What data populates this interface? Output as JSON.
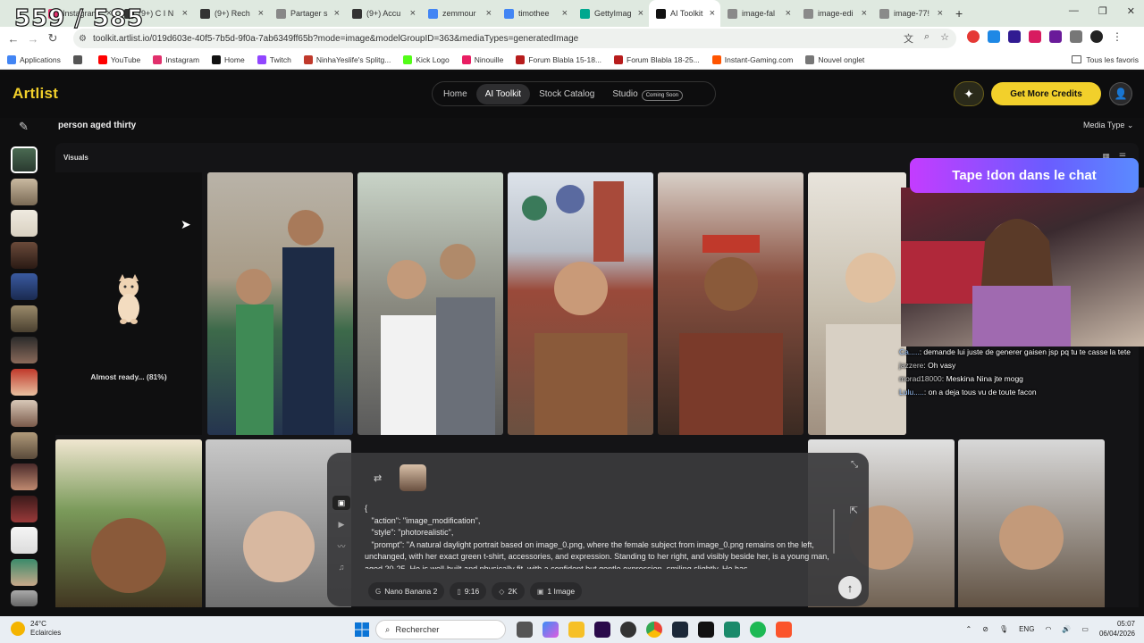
{
  "overlay": {
    "counter": "559 / 585"
  },
  "browser": {
    "tabs": [
      {
        "label": "Instagram",
        "color": "#e1306c"
      },
      {
        "label": "(9+) C I N",
        "color": "#333333"
      },
      {
        "label": "(9+) Rech",
        "color": "#333333"
      },
      {
        "label": "Partager s",
        "color": "#888888"
      },
      {
        "label": "(9+) Accu",
        "color": "#333333"
      },
      {
        "label": "zemmour",
        "color": "#4285f4"
      },
      {
        "label": "timothee",
        "color": "#4285f4"
      },
      {
        "label": "GettyImag",
        "color": "#00a88f"
      },
      {
        "label": "AI Toolkit",
        "color": "#111111",
        "active": true
      },
      {
        "label": "image-fal",
        "color": "#8a8a8a"
      },
      {
        "label": "image-edi",
        "color": "#8a8a8a"
      },
      {
        "label": "image-77!",
        "color": "#8a8a8a"
      }
    ],
    "url": "toolkit.artlist.io/019d603e-40f5-7b5d-9f0a-7ab6349ff65b?mode=image&modelGroupID=363&mediaTypes=generatedImage",
    "bookmarks": [
      {
        "label": "Applications",
        "color": "#4285f4"
      },
      {
        "label": "",
        "color": "#555555"
      },
      {
        "label": "YouTube",
        "color": "#ff0000"
      },
      {
        "label": "Instagram",
        "color": "#e1306c"
      },
      {
        "label": "Home",
        "color": "#111111"
      },
      {
        "label": "Twitch",
        "color": "#9146ff"
      },
      {
        "label": "NinhaYeslife's Splitg...",
        "color": "#c0392b"
      },
      {
        "label": "Kick Logo",
        "color": "#53fc18"
      },
      {
        "label": "Ninouille",
        "color": "#e91e63"
      },
      {
        "label": "Forum Blabla 15-18...",
        "color": "#b71c1c"
      },
      {
        "label": "Forum Blabla 18-25...",
        "color": "#b71c1c"
      },
      {
        "label": "Instant-Gaming.com",
        "color": "#ff5400"
      },
      {
        "label": "Nouvel onglet",
        "color": "#777777"
      }
    ],
    "bookmarks_right": "Tous les favoris"
  },
  "app": {
    "logo": "Artlist",
    "nav": [
      "Home",
      "AI Toolkit",
      "Stock Catalog",
      "Studio"
    ],
    "coming_soon": "Coming Soon",
    "credits_button": "Get More Credits",
    "query": "person aged thirty",
    "media_type": "Media Type",
    "section": "Visuals",
    "loading_text": "Almost ready... (81%)"
  },
  "stream": {
    "banner": "Tape !don dans le chat",
    "chat": [
      {
        "user": "Ca.....",
        "msg": ": demande lui juste de generer gaisen jsp pq tu te casse la tete"
      },
      {
        "user": "jazzere",
        "msg": ": Oh vasy"
      },
      {
        "user": "morad18000",
        "msg": ": Meskina Nina jte mogg"
      },
      {
        "user": "Lulu.....",
        "msg": ": on a deja tous vu de toute facon"
      }
    ]
  },
  "prompt": {
    "text": "{\n   \"action\": \"image_modification\",\n   \"style\": \"photorealistic\",\n   \"prompt\": \"A natural daylight portrait based on image_0.png, where the female subject from image_0.png remains on the left, unchanged, with her exact green t-shirt, accessories, and expression. Standing to her right, and visibly beside her, is a young man, aged 20-25. He is well-built and physically fit, with a confident but gentle expression, smiling slightly. He has",
    "chips": [
      {
        "icon": "G",
        "label": "Nano Banana 2"
      },
      {
        "icon": "▯",
        "label": "9:16"
      },
      {
        "icon": "◇",
        "label": "2K"
      },
      {
        "icon": "▣",
        "label": "1 Image"
      }
    ]
  },
  "taskbar": {
    "weather_temp": "24°C",
    "weather_desc": "Eclaircies",
    "search": "Rechercher",
    "lang": "ENG",
    "time": "05:07",
    "date": "06/04/2026"
  }
}
